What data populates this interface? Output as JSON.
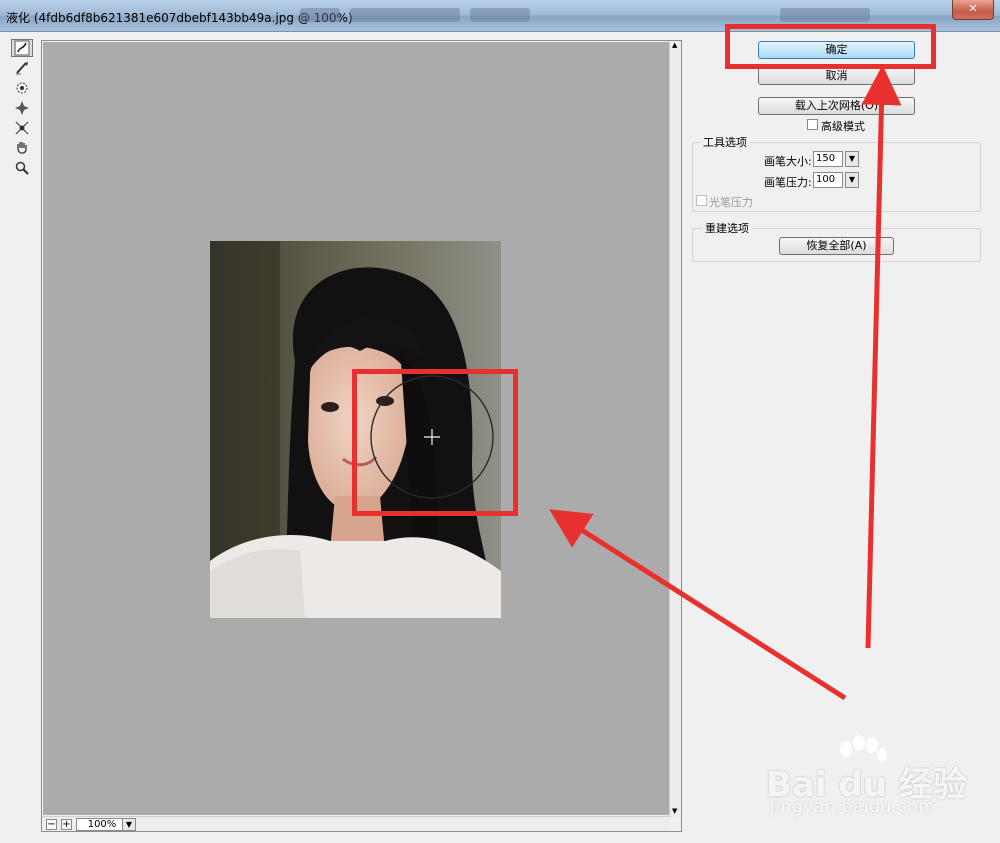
{
  "window": {
    "title": "液化 (4fdb6df8b621381e607dbebf143bb49a.jpg @ 100%)"
  },
  "toolbar": {
    "tools": [
      {
        "icon": "forward-warp-icon"
      },
      {
        "icon": "reconstruct-icon"
      },
      {
        "icon": "twirl-icon"
      },
      {
        "icon": "pucker-icon"
      },
      {
        "icon": "bloat-icon"
      },
      {
        "icon": "hand-icon"
      },
      {
        "icon": "zoom-icon"
      }
    ]
  },
  "canvas": {
    "zoom_value": "100%",
    "zoom_out_glyph": "−",
    "zoom_in_glyph": "+"
  },
  "panel": {
    "ok_label": "确定",
    "cancel_label": "取消",
    "load_mesh_label": "载入上次网格(O)",
    "advanced_mode_label": "高级模式",
    "tool_options": {
      "title": "工具选项",
      "brush_size_label": "画笔大小:",
      "brush_size_value": "150",
      "brush_pressure_label": "画笔压力:",
      "brush_pressure_value": "100",
      "stylus_pressure_label": "光笔压力"
    },
    "reconstruct_options": {
      "title": "重建选项",
      "restore_all_label": "恢复全部(A)"
    }
  },
  "annotation": {
    "color": "#e8302f"
  },
  "watermark": {
    "brand": "Bai du 经验",
    "url": "jingyan.baidu.com"
  }
}
